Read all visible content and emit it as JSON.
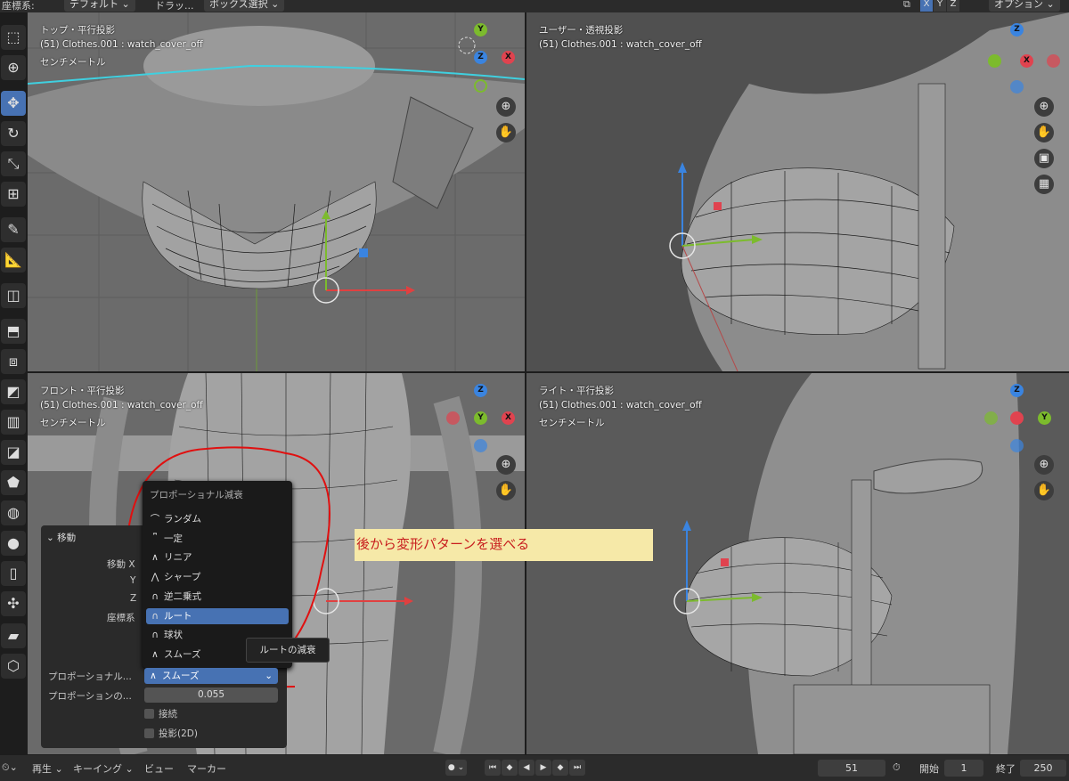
{
  "header": {
    "coord_label": "座標系:",
    "coord_value": "デフォルト",
    "drag_label": "ドラッ...",
    "select_mode": "ボックス選択",
    "axes": [
      "X",
      "Y",
      "Z"
    ],
    "options": "オプション"
  },
  "viewports": {
    "top_left": {
      "title": "トップ・平行投影",
      "object": "(51) Clothes.001 : watch_cover_off",
      "units": "センチメートル",
      "gizmo": {
        "y": "Y",
        "z": "Z",
        "x": "X"
      }
    },
    "top_right": {
      "title": "ユーザー・透視投影",
      "object": "(51) Clothes.001 : watch_cover_off",
      "gizmo": {
        "z": "Z",
        "x": "X"
      }
    },
    "bottom_left": {
      "title": "フロント・平行投影",
      "object": "(51) Clothes.001 : watch_cover_off",
      "units": "センチメートル",
      "gizmo": {
        "z": "Z",
        "y": "Y",
        "x": "X"
      }
    },
    "bottom_right": {
      "title": "ライト・平行投影",
      "object": "(51) Clothes.001 : watch_cover_off",
      "units": "センチメートル",
      "gizmo": {
        "z": "Z",
        "y": "Y"
      }
    }
  },
  "operator_panel": {
    "title": "移動",
    "move_x": "移動 X",
    "y": "Y",
    "z": "Z",
    "orientation": "座標系",
    "proportional": "プロポーショナル...",
    "proportional_size": "プロポーションの...",
    "proportional_size_value": "0.055",
    "connected": "接続",
    "projected": "投影(2D)"
  },
  "falloff_menu": {
    "title": "プロポーショナル減衰",
    "items": [
      {
        "icon": "⌒",
        "label": "ランダム"
      },
      {
        "icon": "⎴",
        "label": "一定"
      },
      {
        "icon": "∧",
        "label": "リニア"
      },
      {
        "icon": "⋀",
        "label": "シャープ"
      },
      {
        "icon": "∩",
        "label": "逆二乗式"
      },
      {
        "icon": "∩",
        "label": "ルート"
      },
      {
        "icon": "∩",
        "label": "球状"
      },
      {
        "icon": "∧",
        "label": "スムーズ"
      }
    ],
    "selected_index": 5,
    "tooltip": "ルートの減衰",
    "current_value": "スムーズ"
  },
  "annotation": "後から変形パターンを選べる",
  "timeline": {
    "playback": "再生",
    "keying": "キーイング",
    "view": "ビュー",
    "marker": "マーカー",
    "current_frame": "51",
    "start_label": "開始",
    "start": "1",
    "end_label": "終了",
    "end": "250"
  },
  "colors": {
    "accent": "#4772b3",
    "axis_x": "#e0434f",
    "axis_y": "#7cbb2d",
    "axis_z": "#3a84e0",
    "annotation_bg": "#f6e9a8",
    "annotation_text": "#c81e1e",
    "highlight_circle": "#e01010"
  }
}
